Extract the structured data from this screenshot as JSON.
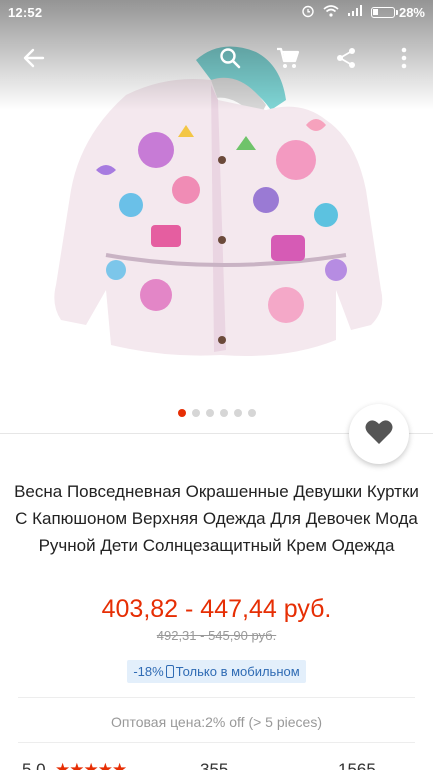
{
  "status_bar": {
    "time": "12:52",
    "battery": "28%",
    "battery_level": 0.28
  },
  "appbar": {
    "icons": [
      "back-arrow-icon",
      "search-icon",
      "cart-icon",
      "share-icon",
      "more-vert-icon"
    ]
  },
  "gallery": {
    "total_images": 6,
    "active_index": 0
  },
  "product": {
    "title": "Весна Повседневная Окрашенные Девушки Куртки С Капюшоном Верхняя Одежда Для Девочек Мода Ручной Дети Солнцезащитный Крем Одежда",
    "price": "403,82 - 447,44 руб.",
    "old_price": "492,31 - 545,90 руб.",
    "discount": "-18%",
    "mobile_only": "Только в мобильном",
    "wholesale": "Оптовая цена:2% off (> 5 pieces)"
  },
  "stats": {
    "rating": "5.0",
    "orders": "355",
    "reviews": "1565"
  },
  "colors": {
    "accent": "#e62e04",
    "badge_bg": "#e3effb",
    "badge_text": "#2f6bb4"
  }
}
